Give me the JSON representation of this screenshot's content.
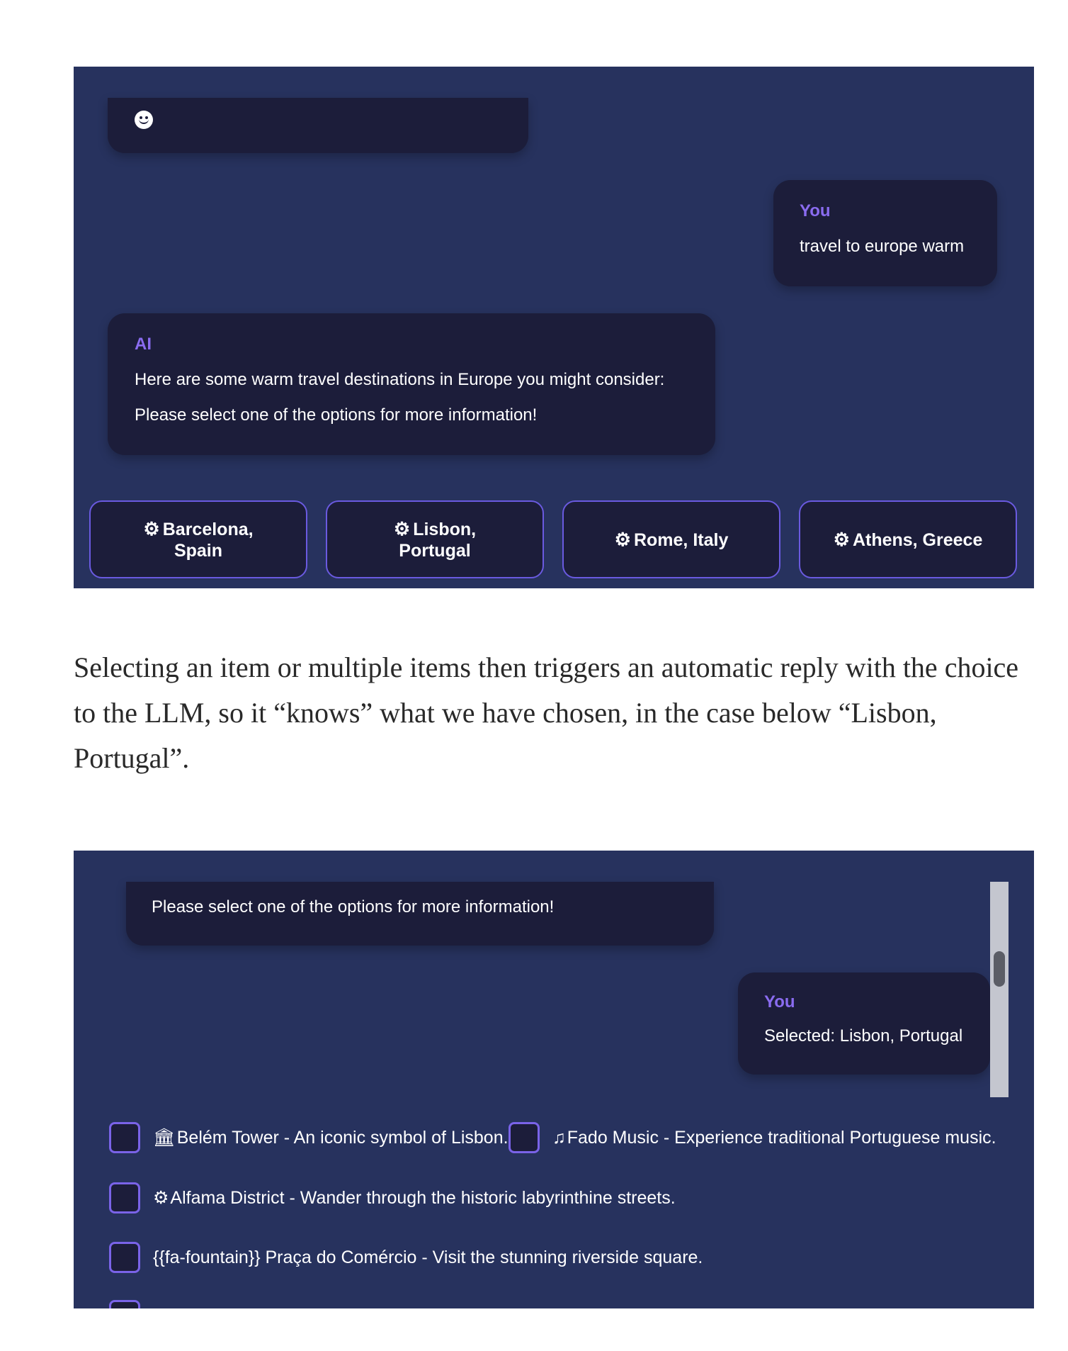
{
  "chat1": {
    "top_bubble_icon": "smiley-icon",
    "user_message": {
      "sender": "You",
      "text": "travel to europe warm"
    },
    "ai_message": {
      "sender": "AI",
      "lines": [
        "Here are some warm travel destinations in Europe you might consider:",
        "Please select one of the options for more information!"
      ]
    },
    "options": [
      {
        "icon": "gear-icon",
        "label": "Barcelona, Spain"
      },
      {
        "icon": "gear-icon",
        "label": "Lisbon, Portugal"
      },
      {
        "icon": "gear-icon",
        "label": "Rome, Italy"
      },
      {
        "icon": "gear-icon",
        "label": "Athens, Greece"
      }
    ]
  },
  "article": {
    "paragraph": "Selecting an item or multiple items then triggers an automatic reply with the choice to the LLM, so it “knows” what we have chosen, in the case below “Lisbon, Portugal”."
  },
  "chat2": {
    "ai_message_text": "Please select one of the options for more information!",
    "user_message": {
      "sender": "You",
      "text": "Selected: Lisbon, Portugal"
    },
    "checkbox_items": [
      {
        "icon": "landmark-icon",
        "glyph": "🏛",
        "label": "Belém Tower - An iconic symbol of Lisbon."
      },
      {
        "icon": "music-note-icon",
        "glyph": "♫",
        "label": "Fado Music - Experience traditional Portuguese music."
      },
      {
        "icon": "gear-icon",
        "glyph": "⚙",
        "label": "Alfama District - Wander through the historic labyrinthine streets."
      },
      {
        "icon": "",
        "glyph": "",
        "label": "{{fa-fountain}} Praça do Comércio - Visit the stunning riverside square."
      }
    ]
  },
  "colors": {
    "panel_bg": "#27325e",
    "bubble_bg": "#1c1d3a",
    "accent": "#8a6cf0",
    "border_accent": "#6a5ae0"
  }
}
